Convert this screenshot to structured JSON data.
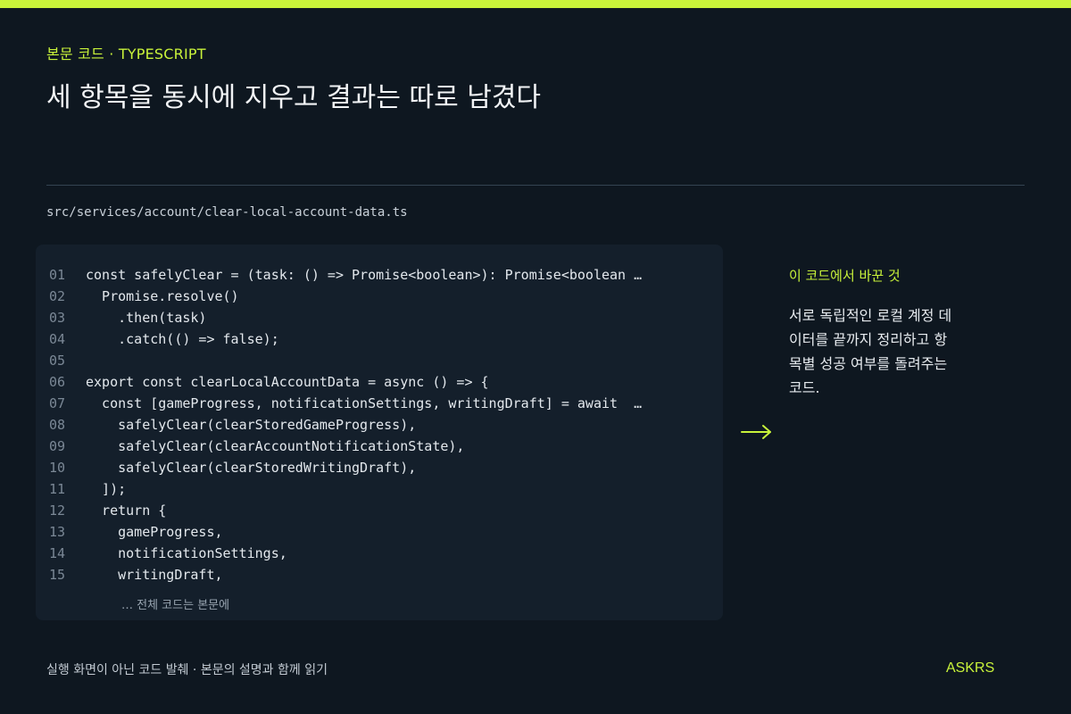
{
  "colors": {
    "accent": "#c8f23a",
    "background": "#0e1720",
    "panel": "#141f2b"
  },
  "header": {
    "eyebrow": "본문 코드 · TYPESCRIPT",
    "title": "세 항목을 동시에 지우고 결과는 따로 남겼다"
  },
  "file": {
    "path": "src/services/account/clear-local-account-data.ts"
  },
  "code": {
    "lines": [
      {
        "no": "01",
        "text": "const safelyClear = (task: () => Promise<boolean>): Promise<boolean …"
      },
      {
        "no": "02",
        "text": "  Promise.resolve()"
      },
      {
        "no": "03",
        "text": "    .then(task)"
      },
      {
        "no": "04",
        "text": "    .catch(() => false);"
      },
      {
        "no": "05",
        "text": ""
      },
      {
        "no": "06",
        "text": "export const clearLocalAccountData = async () => {"
      },
      {
        "no": "07",
        "text": "  const [gameProgress, notificationSettings, writingDraft] = await  …"
      },
      {
        "no": "08",
        "text": "    safelyClear(clearStoredGameProgress),"
      },
      {
        "no": "09",
        "text": "    safelyClear(clearAccountNotificationState),"
      },
      {
        "no": "10",
        "text": "    safelyClear(clearStoredWritingDraft),"
      },
      {
        "no": "11",
        "text": "  ]);"
      },
      {
        "no": "12",
        "text": "  return {"
      },
      {
        "no": "13",
        "text": "    gameProgress,"
      },
      {
        "no": "14",
        "text": "    notificationSettings,"
      },
      {
        "no": "15",
        "text": "    writingDraft,"
      }
    ],
    "more": "… 전체 코드는 본문에"
  },
  "note": {
    "arrow_icon": "arrow-right-icon",
    "title": "이 코드에서 바꾼 것",
    "body_lines": [
      "서로 독립적인 로컬 계정 데",
      "이터를 끝까지 정리하고 항",
      "목별 성공 여부를 돌려주는",
      "코드."
    ]
  },
  "footer": {
    "caption": "실행 화면이 아닌 코드 발췌 · 본문의 설명과 함께 읽기",
    "brand": "ASKRS"
  }
}
